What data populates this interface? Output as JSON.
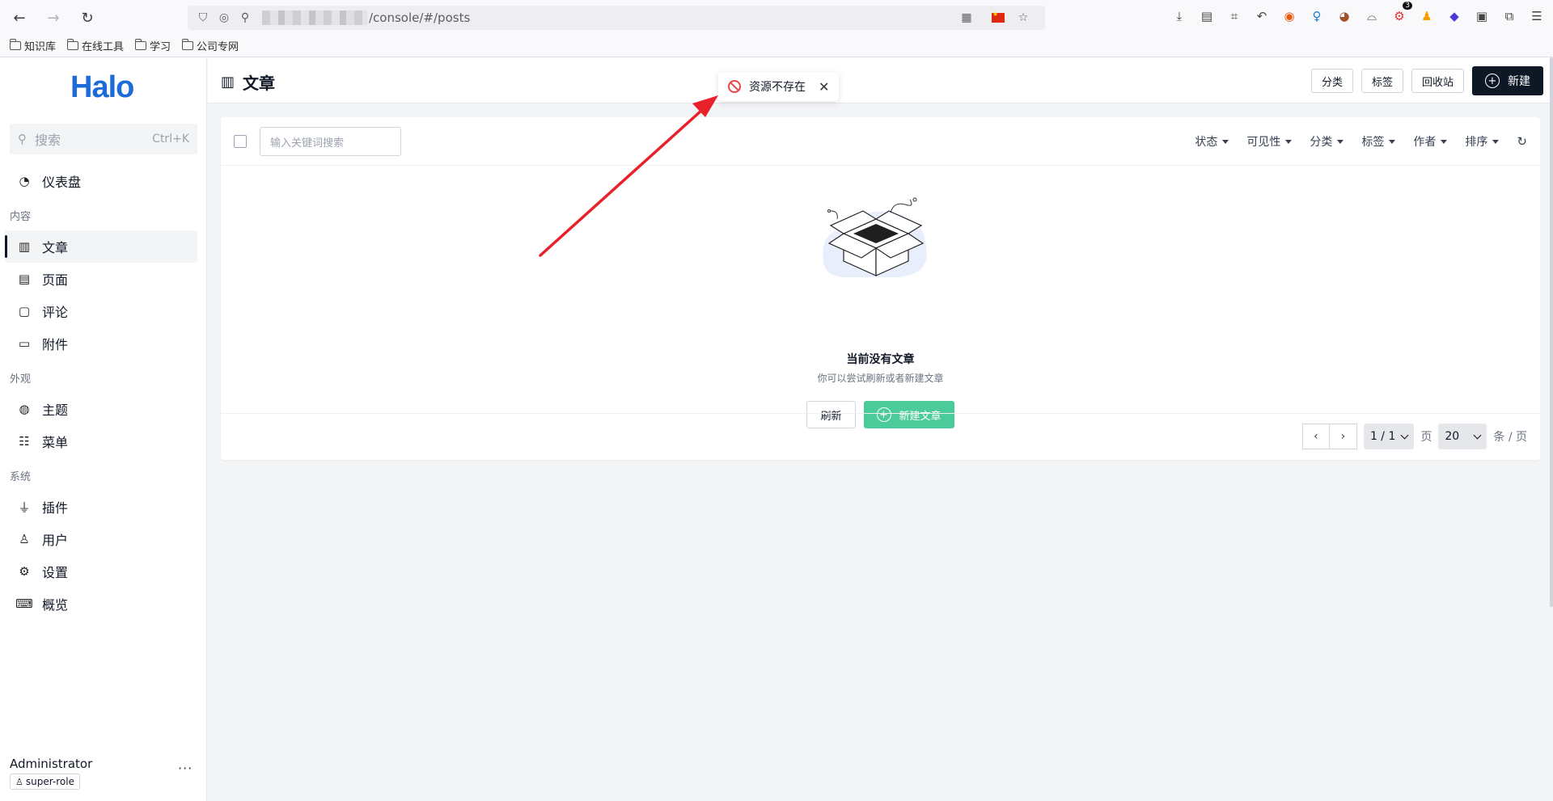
{
  "browser": {
    "url_suffix": "/console/#/posts",
    "bookmarks": [
      "知识库",
      "在线工具",
      "学习",
      "公司专网"
    ],
    "ext_badge": "3"
  },
  "sidebar": {
    "logo": "Halo",
    "search_placeholder": "搜索",
    "search_shortcut": "Ctrl+K",
    "dashboard": "仪表盘",
    "groups": {
      "content": "内容",
      "appearance": "外观",
      "system": "系统"
    },
    "items": {
      "posts": "文章",
      "pages": "页面",
      "comments": "评论",
      "attachments": "附件",
      "themes": "主题",
      "menus": "菜单",
      "plugins": "插件",
      "users": "用户",
      "settings": "设置",
      "overview": "概览"
    },
    "user": {
      "name": "Administrator",
      "role": "super-role",
      "more": "···"
    }
  },
  "header": {
    "title": "文章",
    "buttons": {
      "category": "分类",
      "tag": "标签",
      "recycle": "回收站",
      "new": "新建"
    }
  },
  "toast": {
    "message": "资源不存在"
  },
  "toolbar": {
    "search_placeholder": "输入关键词搜索",
    "filters": [
      "状态",
      "可见性",
      "分类",
      "标签",
      "作者",
      "排序"
    ]
  },
  "empty": {
    "title": "当前没有文章",
    "subtitle": "你可以尝试刷新或者新建文章",
    "refresh": "刷新",
    "new_post": "新建文章"
  },
  "pagination": {
    "page": "1 / 1",
    "page_unit": "页",
    "size": "20",
    "size_unit": "条 / 页"
  },
  "colors": {
    "accent_dark": "#0e1726",
    "primary_green": "#4ccb9a",
    "logo_blue": "#1d6bd6",
    "error_red": "#ef4444",
    "annotation_arrow": "#e8212a"
  }
}
